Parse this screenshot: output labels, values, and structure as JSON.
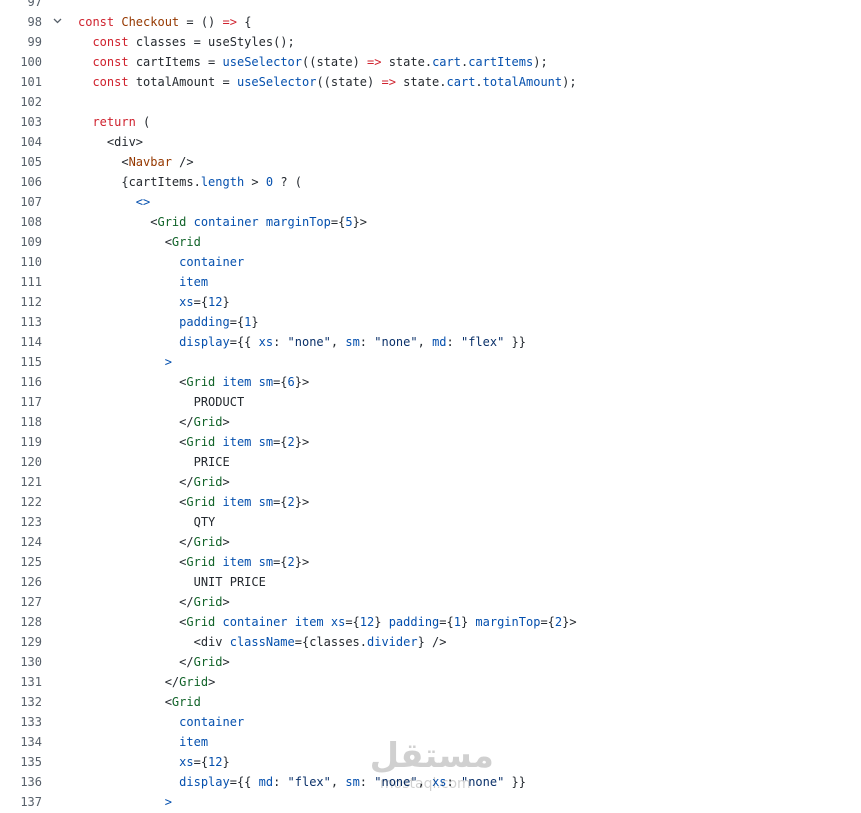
{
  "editor": {
    "colors": {
      "keyword": "#cf222e",
      "tag": "#116329",
      "attribute": "#0550ae",
      "function": "#0550ae",
      "string": "#0a3069",
      "variable": "#953800",
      "default": "#24292f",
      "line_number": "#57606a"
    },
    "fold_icon": "chevron-down-icon",
    "lines": [
      {
        "n": "97",
        "tokens": []
      },
      {
        "n": "98",
        "fold": true,
        "tokens": [
          [
            "k",
            "const "
          ],
          [
            "v",
            "Checkout"
          ],
          [
            "d",
            " = () "
          ],
          [
            "k",
            "=>"
          ],
          [
            "d",
            " {"
          ]
        ]
      },
      {
        "n": "99",
        "tokens": [
          [
            "d",
            "  "
          ],
          [
            "k",
            "const "
          ],
          [
            "d",
            "classes = useStyles();"
          ]
        ]
      },
      {
        "n": "100",
        "tokens": [
          [
            "d",
            "  "
          ],
          [
            "k",
            "const "
          ],
          [
            "d",
            "cartItems = "
          ],
          [
            "f",
            "useSelector"
          ],
          [
            "d",
            "((state) "
          ],
          [
            "k",
            "=>"
          ],
          [
            "d",
            " state."
          ],
          [
            "a",
            "cart"
          ],
          [
            "d",
            "."
          ],
          [
            "a",
            "cartItems"
          ],
          [
            "d",
            ");"
          ]
        ]
      },
      {
        "n": "101",
        "tokens": [
          [
            "d",
            "  "
          ],
          [
            "k",
            "const "
          ],
          [
            "d",
            "totalAmount = "
          ],
          [
            "f",
            "useSelector"
          ],
          [
            "d",
            "((state) "
          ],
          [
            "k",
            "=>"
          ],
          [
            "d",
            " state."
          ],
          [
            "a",
            "cart"
          ],
          [
            "d",
            "."
          ],
          [
            "a",
            "totalAmount"
          ],
          [
            "d",
            ");"
          ]
        ]
      },
      {
        "n": "102",
        "tokens": []
      },
      {
        "n": "103",
        "tokens": [
          [
            "d",
            "  "
          ],
          [
            "k",
            "return"
          ],
          [
            "d",
            " ("
          ]
        ]
      },
      {
        "n": "104",
        "tokens": [
          [
            "d",
            "    <div>"
          ]
        ]
      },
      {
        "n": "105",
        "tokens": [
          [
            "d",
            "      <"
          ],
          [
            "v",
            "Navbar"
          ],
          [
            "d",
            " />"
          ]
        ]
      },
      {
        "n": "106",
        "tokens": [
          [
            "d",
            "      {cartItems."
          ],
          [
            "a",
            "length"
          ],
          [
            "d",
            " > "
          ],
          [
            "n",
            "0"
          ],
          [
            "d",
            " ? ("
          ]
        ]
      },
      {
        "n": "107",
        "tokens": [
          [
            "d",
            "        "
          ],
          [
            "o",
            "<>"
          ]
        ]
      },
      {
        "n": "108",
        "tokens": [
          [
            "d",
            "          <"
          ],
          [
            "t",
            "Grid"
          ],
          [
            "a",
            " container marginTop"
          ],
          [
            "d",
            "={"
          ],
          [
            "n",
            "5"
          ],
          [
            "d",
            "}>"
          ]
        ]
      },
      {
        "n": "109",
        "tokens": [
          [
            "d",
            "            <"
          ],
          [
            "t",
            "Grid"
          ]
        ]
      },
      {
        "n": "110",
        "tokens": [
          [
            "a",
            "              container"
          ]
        ]
      },
      {
        "n": "111",
        "tokens": [
          [
            "a",
            "              item"
          ]
        ]
      },
      {
        "n": "112",
        "tokens": [
          [
            "a",
            "              xs"
          ],
          [
            "d",
            "={"
          ],
          [
            "n",
            "12"
          ],
          [
            "d",
            "}"
          ]
        ]
      },
      {
        "n": "113",
        "tokens": [
          [
            "a",
            "              padding"
          ],
          [
            "d",
            "={"
          ],
          [
            "n",
            "1"
          ],
          [
            "d",
            "}"
          ]
        ]
      },
      {
        "n": "114",
        "tokens": [
          [
            "a",
            "              display"
          ],
          [
            "d",
            "={{ "
          ],
          [
            "a",
            "xs"
          ],
          [
            "d",
            ": "
          ],
          [
            "s",
            "\"none\""
          ],
          [
            "d",
            ", "
          ],
          [
            "a",
            "sm"
          ],
          [
            "d",
            ": "
          ],
          [
            "s",
            "\"none\""
          ],
          [
            "d",
            ", "
          ],
          [
            "a",
            "md"
          ],
          [
            "d",
            ": "
          ],
          [
            "s",
            "\"flex\""
          ],
          [
            "d",
            " }}"
          ]
        ]
      },
      {
        "n": "115",
        "tokens": [
          [
            "o",
            "            >"
          ]
        ]
      },
      {
        "n": "116",
        "tokens": [
          [
            "d",
            "              <"
          ],
          [
            "t",
            "Grid"
          ],
          [
            "a",
            " item sm"
          ],
          [
            "d",
            "={"
          ],
          [
            "n",
            "6"
          ],
          [
            "d",
            "}>"
          ]
        ]
      },
      {
        "n": "117",
        "tokens": [
          [
            "d",
            "                PRODUCT"
          ]
        ]
      },
      {
        "n": "118",
        "tokens": [
          [
            "d",
            "              </"
          ],
          [
            "t",
            "Grid"
          ],
          [
            "d",
            ">"
          ]
        ]
      },
      {
        "n": "119",
        "tokens": [
          [
            "d",
            "              <"
          ],
          [
            "t",
            "Grid"
          ],
          [
            "a",
            " item sm"
          ],
          [
            "d",
            "={"
          ],
          [
            "n",
            "2"
          ],
          [
            "d",
            "}>"
          ]
        ]
      },
      {
        "n": "120",
        "tokens": [
          [
            "d",
            "                PRICE"
          ]
        ]
      },
      {
        "n": "121",
        "tokens": [
          [
            "d",
            "              </"
          ],
          [
            "t",
            "Grid"
          ],
          [
            "d",
            ">"
          ]
        ]
      },
      {
        "n": "122",
        "tokens": [
          [
            "d",
            "              <"
          ],
          [
            "t",
            "Grid"
          ],
          [
            "a",
            " item sm"
          ],
          [
            "d",
            "={"
          ],
          [
            "n",
            "2"
          ],
          [
            "d",
            "}>"
          ]
        ]
      },
      {
        "n": "123",
        "tokens": [
          [
            "d",
            "                QTY"
          ]
        ]
      },
      {
        "n": "124",
        "tokens": [
          [
            "d",
            "              </"
          ],
          [
            "t",
            "Grid"
          ],
          [
            "d",
            ">"
          ]
        ]
      },
      {
        "n": "125",
        "tokens": [
          [
            "d",
            "              <"
          ],
          [
            "t",
            "Grid"
          ],
          [
            "a",
            " item sm"
          ],
          [
            "d",
            "={"
          ],
          [
            "n",
            "2"
          ],
          [
            "d",
            "}>"
          ]
        ]
      },
      {
        "n": "126",
        "tokens": [
          [
            "d",
            "                UNIT PRICE"
          ]
        ]
      },
      {
        "n": "127",
        "tokens": [
          [
            "d",
            "              </"
          ],
          [
            "t",
            "Grid"
          ],
          [
            "d",
            ">"
          ]
        ]
      },
      {
        "n": "128",
        "tokens": [
          [
            "d",
            "              <"
          ],
          [
            "t",
            "Grid"
          ],
          [
            "a",
            " container item xs"
          ],
          [
            "d",
            "={"
          ],
          [
            "n",
            "12"
          ],
          [
            "d",
            "}"
          ],
          [
            "a",
            " padding"
          ],
          [
            "d",
            "={"
          ],
          [
            "n",
            "1"
          ],
          [
            "d",
            "}"
          ],
          [
            "a",
            " marginTop"
          ],
          [
            "d",
            "={"
          ],
          [
            "n",
            "2"
          ],
          [
            "d",
            "}>"
          ]
        ]
      },
      {
        "n": "129",
        "tokens": [
          [
            "d",
            "                <div "
          ],
          [
            "a",
            "className"
          ],
          [
            "d",
            "={classes."
          ],
          [
            "a",
            "divider"
          ],
          [
            "d",
            "} />"
          ]
        ]
      },
      {
        "n": "130",
        "tokens": [
          [
            "d",
            "              </"
          ],
          [
            "t",
            "Grid"
          ],
          [
            "d",
            ">"
          ]
        ]
      },
      {
        "n": "131",
        "tokens": [
          [
            "d",
            "            </"
          ],
          [
            "t",
            "Grid"
          ],
          [
            "d",
            ">"
          ]
        ]
      },
      {
        "n": "132",
        "tokens": [
          [
            "d",
            "            <"
          ],
          [
            "t",
            "Grid"
          ]
        ]
      },
      {
        "n": "133",
        "tokens": [
          [
            "a",
            "              container"
          ]
        ]
      },
      {
        "n": "134",
        "tokens": [
          [
            "a",
            "              item"
          ]
        ]
      },
      {
        "n": "135",
        "tokens": [
          [
            "a",
            "              xs"
          ],
          [
            "d",
            "={"
          ],
          [
            "n",
            "12"
          ],
          [
            "d",
            "}"
          ]
        ]
      },
      {
        "n": "136",
        "tokens": [
          [
            "a",
            "              display"
          ],
          [
            "d",
            "={{ "
          ],
          [
            "a",
            "md"
          ],
          [
            "d",
            ": "
          ],
          [
            "s",
            "\"flex\""
          ],
          [
            "d",
            ", "
          ],
          [
            "a",
            "sm"
          ],
          [
            "d",
            ": "
          ],
          [
            "s",
            "\"none\""
          ],
          [
            "d",
            ", "
          ],
          [
            "a",
            "xs"
          ],
          [
            "d",
            ": "
          ],
          [
            "s",
            "\"none\""
          ],
          [
            "d",
            " }}"
          ]
        ]
      },
      {
        "n": "137",
        "tokens": [
          [
            "o",
            "            >"
          ]
        ]
      }
    ]
  },
  "watermark": {
    "main": "مستقل",
    "sub": "mostaql.com"
  }
}
